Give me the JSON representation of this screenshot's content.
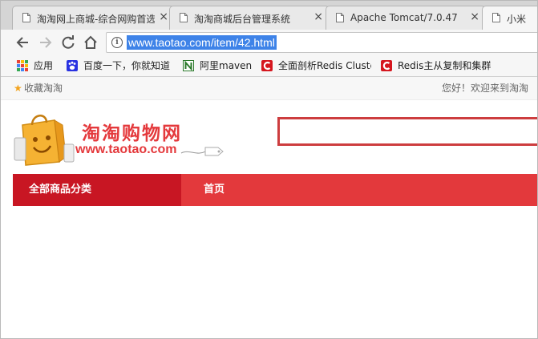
{
  "browser": {
    "tabs": [
      {
        "title": "淘淘网上商城-综合网购首选",
        "icon": "page-icon",
        "close": "×",
        "active": false
      },
      {
        "title": "淘淘商城后台管理系统",
        "icon": "page-icon",
        "close": "×",
        "active": false
      },
      {
        "title": "Apache Tomcat/7.0.47",
        "icon": "page-icon",
        "close": "×",
        "active": false
      },
      {
        "title": "小米",
        "icon": "page-icon",
        "close": "×",
        "active": true
      }
    ],
    "address_bar": {
      "url": "www.taotao.com/item/42.html",
      "info_icon": "i"
    },
    "bookmarks": [
      {
        "label": "应用",
        "icon": "apps-grid-icon"
      },
      {
        "label": "百度一下，你就知道",
        "icon": "baidu-paw-icon"
      },
      {
        "label": "阿里maven",
        "icon": "nexus-icon"
      },
      {
        "label": "全面剖析Redis Cluster",
        "icon": "csdn-icon"
      },
      {
        "label": "Redis主从复制和集群",
        "icon": "csdn-icon"
      }
    ]
  },
  "site": {
    "topbar": {
      "favorite": "收藏淘淘",
      "welcome": "您好！欢迎来到淘淘"
    },
    "logo": {
      "title": "淘淘购物网",
      "domain": "www.taotao.com"
    },
    "search": {
      "value": "",
      "placeholder": ""
    },
    "nav": {
      "all_categories": "全部商品分类",
      "home": "首页"
    }
  },
  "colors": {
    "brand_red": "#e4393c",
    "category_red": "#c81623",
    "url_highlight": "#3e83e8",
    "search_border": "#cd3d3f"
  }
}
